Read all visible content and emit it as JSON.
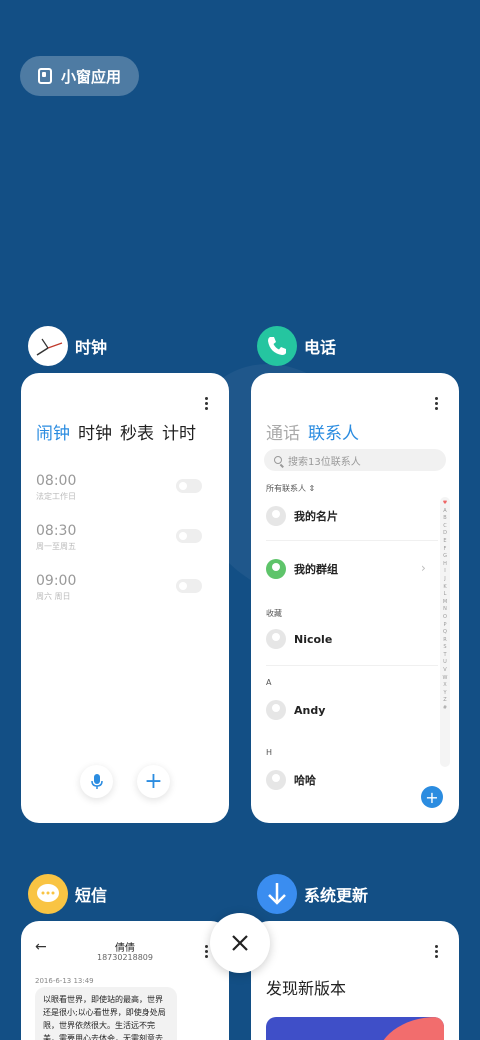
{
  "mini_window": {
    "label": "小窗应用"
  },
  "apps": {
    "clock": {
      "name": "时钟",
      "tabs": [
        "闹钟",
        "时钟",
        "秒表",
        "计时"
      ],
      "alarms": [
        {
          "time": "08:00",
          "repeat": "法定工作日"
        },
        {
          "time": "08:30",
          "repeat": "周一至周五"
        },
        {
          "time": "09:00",
          "repeat": "周六 周日"
        }
      ]
    },
    "phone": {
      "name": "电话",
      "tabs": [
        "通话",
        "联系人"
      ],
      "search_placeholder": "搜索13位联系人",
      "all_contacts": "所有联系人",
      "my_card": "我的名片",
      "my_groups": "我的群组",
      "favorites_label": "收藏",
      "favorite_contact": "Nicole",
      "section_a": "A",
      "contact_a": "Andy",
      "section_h": "H",
      "contact_h": "哈哈",
      "index": [
        "♥",
        "A",
        "B",
        "C",
        "D",
        "E",
        "F",
        "G",
        "H",
        "I",
        "J",
        "K",
        "L",
        "M",
        "N",
        "O",
        "P",
        "Q",
        "R",
        "S",
        "T",
        "U",
        "V",
        "W",
        "X",
        "Y",
        "Z",
        "#"
      ]
    },
    "messages": {
      "name": "短信",
      "contact_name": "倩倩",
      "contact_number": "18730218809",
      "date": "2016-6-13 13:49",
      "text": "以眼看世界，即使站的最高，世界还是很小;以心看世界，即使身处局限，世界依然很大。生活远不完美，需要用心去体会，无需刻意去"
    },
    "update": {
      "name": "系统更新",
      "title": "发现新版本"
    }
  },
  "colors": {
    "background": "#134f85",
    "accent": "#2b8ce0",
    "phone_icon": "#25c5a0",
    "messages_icon": "#f9c443",
    "update_icon": "#3a8df0"
  }
}
